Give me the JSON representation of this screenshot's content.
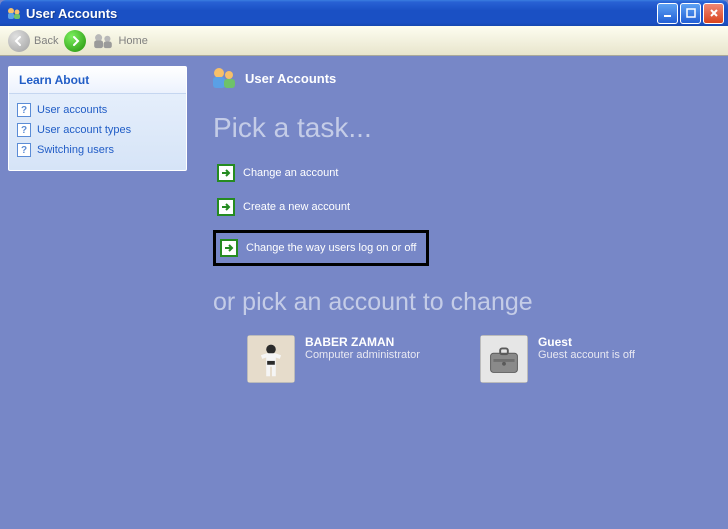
{
  "window": {
    "title": "User Accounts"
  },
  "toolbar": {
    "back_label": "Back",
    "home_label": "Home"
  },
  "sidebar": {
    "panel_title": "Learn About",
    "links": [
      {
        "label": "User accounts"
      },
      {
        "label": "User account types"
      },
      {
        "label": "Switching users"
      }
    ]
  },
  "main": {
    "header_title": "User Accounts",
    "headline1": "Pick a task...",
    "tasks": [
      {
        "label": "Change an account"
      },
      {
        "label": "Create a new account"
      },
      {
        "label": "Change the way users log on or off"
      }
    ],
    "headline2": "or pick an account to change",
    "accounts": [
      {
        "name": "BABER ZAMAN",
        "desc": "Computer administrator"
      },
      {
        "name": "Guest",
        "desc": "Guest account is off"
      }
    ]
  }
}
